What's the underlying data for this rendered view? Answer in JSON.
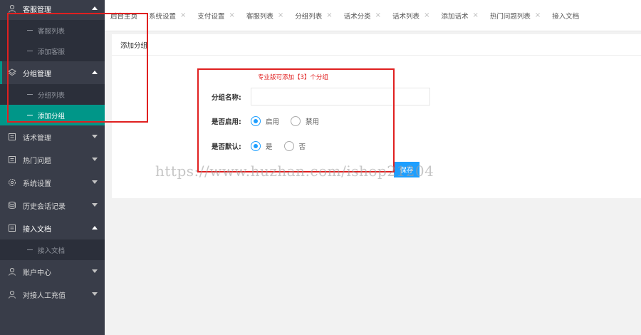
{
  "sidebar": {
    "groups": [
      {
        "label": "客服管理",
        "icon": "user-icon",
        "open": true,
        "items": [
          {
            "label": "客服列表"
          },
          {
            "label": "添加客服"
          }
        ]
      },
      {
        "label": "分组管理",
        "icon": "layers-icon",
        "open": true,
        "items": [
          {
            "label": "分组列表"
          },
          {
            "label": "添加分组",
            "active": true
          }
        ]
      },
      {
        "label": "话术管理",
        "icon": "document-icon",
        "open": false,
        "items": []
      },
      {
        "label": "热门问题",
        "icon": "document-icon",
        "open": false,
        "items": []
      },
      {
        "label": "系统设置",
        "icon": "gear-icon",
        "open": false,
        "items": []
      },
      {
        "label": "历史会话记录",
        "icon": "database-icon",
        "open": false,
        "items": []
      },
      {
        "label": "接入文档",
        "icon": "document-icon",
        "open": true,
        "items": [
          {
            "label": "接入文档"
          }
        ]
      },
      {
        "label": "账户中心",
        "icon": "user-icon",
        "open": false,
        "items": []
      },
      {
        "label": "对接人工充值",
        "icon": "user-icon",
        "open": false,
        "items": []
      }
    ]
  },
  "tabs": {
    "home": "后台主页",
    "items": [
      "系统设置",
      "支付设置",
      "客服列表",
      "分组列表",
      "话术分类",
      "话术列表",
      "添加话术",
      "热门问题列表",
      "接入文档"
    ],
    "close_glyph": "×"
  },
  "page": {
    "card_title": "添加分组",
    "notice": "专业版可添加【3】个分组",
    "name_label": "分组名称:",
    "name_value": "",
    "enable_label": "是否启用:",
    "enable_options": [
      "启用",
      "禁用"
    ],
    "enable_selected": "启用",
    "default_label": "是否默认:",
    "default_options": [
      "是",
      "否"
    ],
    "default_selected": "是",
    "save_label": "保存"
  },
  "watermark": "https://www.huzhan.com/ishop21204",
  "colors": {
    "sidebar_bg": "#393d49",
    "sidebar_sub_bg": "#2b2f3a",
    "active": "#009688",
    "primary": "#1e9fff",
    "annotation": "#e02020"
  }
}
